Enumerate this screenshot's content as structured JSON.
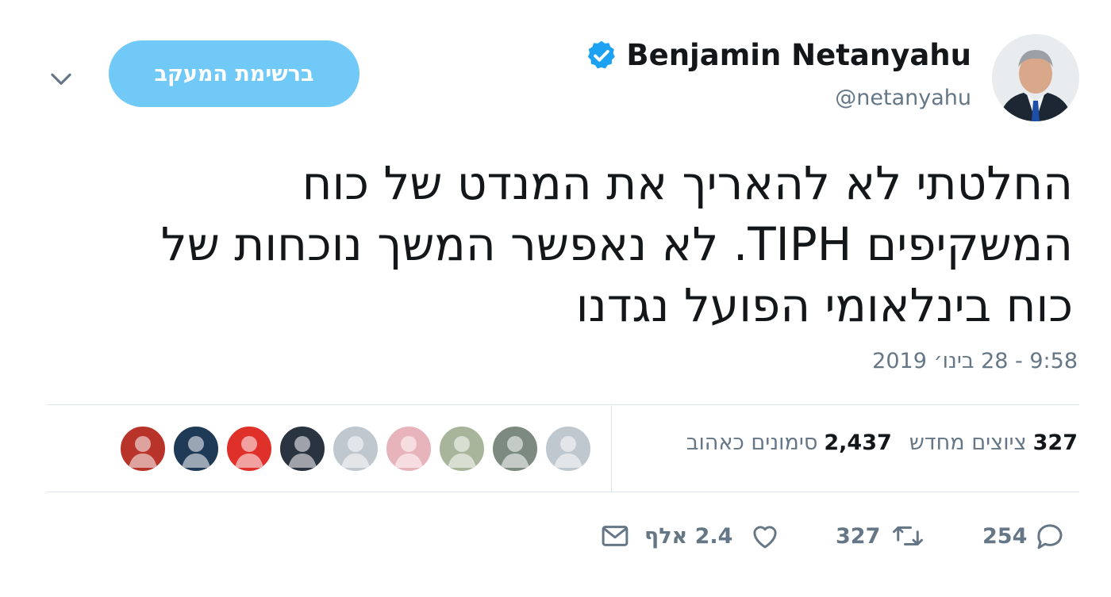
{
  "author": {
    "display_name": "Benjamin Netanyahu",
    "handle": "@netanyahu",
    "verified": true
  },
  "follow_button": {
    "label": "ברשימת המעקב"
  },
  "tweet": {
    "lines": [
      "החלטתי לא להאריך את המנדט של כוח",
      "המשקיפים TIPH. לא נאפשר המשך נוכחות של",
      "כוח בינלאומי הפועל נגדנו"
    ],
    "timestamp": "9:58 - 28 בינו׳ 2019"
  },
  "stats": {
    "retweets_count": "327",
    "retweets_label": "ציוצים מחדש",
    "likes_count": "2,437",
    "likes_label": "סימונים כאהוב"
  },
  "likers": [
    {
      "name": "liker-avatar-1",
      "color": "#c0c8cf"
    },
    {
      "name": "liker-avatar-2",
      "color": "#7d8a80"
    },
    {
      "name": "liker-avatar-3",
      "color": "#a8b59a"
    },
    {
      "name": "liker-avatar-4",
      "color": "#e8b4bc"
    },
    {
      "name": "liker-avatar-5",
      "color": "#c0c8cf"
    },
    {
      "name": "liker-avatar-6",
      "color": "#2a3440"
    },
    {
      "name": "liker-avatar-7",
      "color": "#e0302a"
    },
    {
      "name": "liker-avatar-8",
      "color": "#1f3a57"
    },
    {
      "name": "liker-avatar-9",
      "color": "#b8342a"
    }
  ],
  "actions": {
    "reply_count": "254",
    "retweet_count": "327",
    "like_count": "2.4 אלף"
  },
  "colors": {
    "accent": "#1da1f2",
    "follow_button": "#71c9f8",
    "secondary_text": "#657786",
    "primary_text": "#14171a",
    "divider": "#e1e8ed"
  },
  "icons": {
    "verified": "verified-badge-icon",
    "chevron": "chevron-down-icon",
    "reply": "reply-icon",
    "retweet": "retweet-icon",
    "like": "heart-icon",
    "dm": "envelope-icon"
  }
}
